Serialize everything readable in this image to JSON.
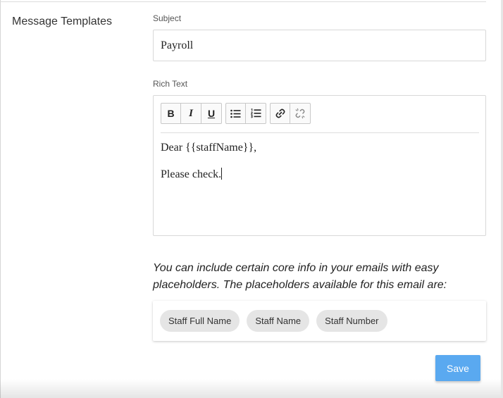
{
  "section": {
    "title": "Message Templates"
  },
  "subject": {
    "label": "Subject",
    "value": "Payroll"
  },
  "rich_text": {
    "label": "Rich Text",
    "toolbar": {
      "bold": "B",
      "italic": "I",
      "underline": "U",
      "icons": [
        "bold-icon",
        "italic-icon",
        "underline-icon",
        "bullet-list-icon",
        "numbered-list-icon",
        "link-icon",
        "unlink-icon"
      ]
    },
    "content": {
      "line1": "Dear {{staffName}},",
      "line2": "Please check."
    }
  },
  "placeholders": {
    "info": "You can include certain core info in your emails with easy placeholders. The placeholders available for this email are:",
    "chips": [
      "Staff Full Name",
      "Staff Name",
      "Staff Number"
    ]
  },
  "actions": {
    "save_label": "Save"
  },
  "colors": {
    "accent": "#5aa9f0",
    "chip_bg": "#e5e5e5"
  }
}
